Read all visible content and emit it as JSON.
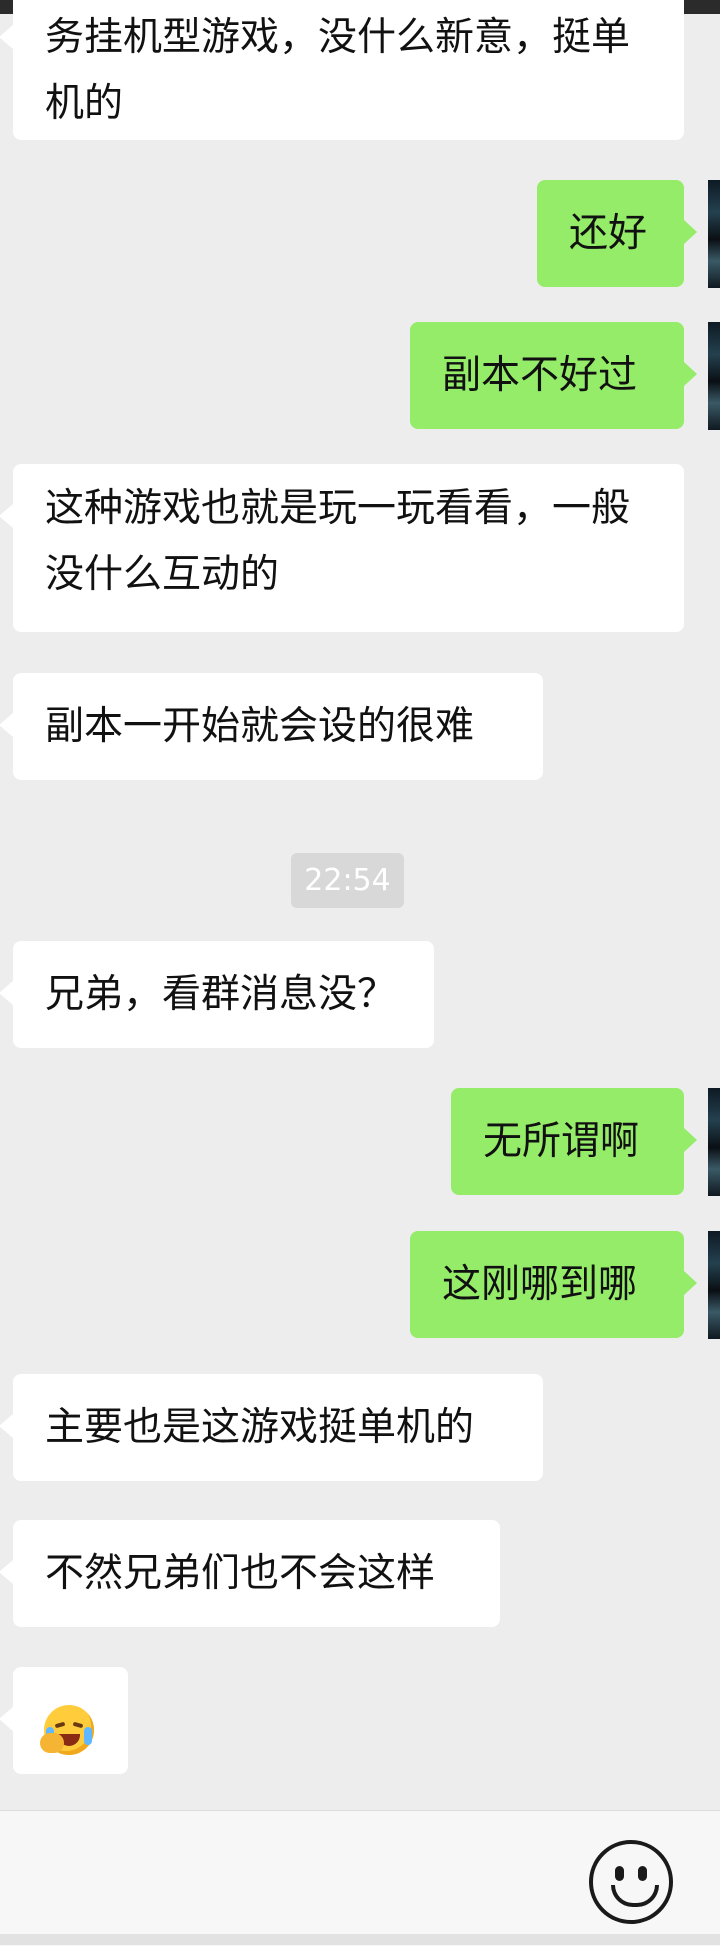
{
  "timestamp": "22:54",
  "messages": [
    {
      "side": "left",
      "text": "务挂机型游戏，没什么新意，挺单机的"
    },
    {
      "side": "right",
      "text": "还好"
    },
    {
      "side": "right",
      "text": "副本不好过"
    },
    {
      "side": "left",
      "text": "这种游戏也就是玩一玩看看，一般没什么互动的"
    },
    {
      "side": "left",
      "text": "副本一开始就会设的很难"
    },
    {
      "side": "left",
      "text": "兄弟，看群消息没？"
    },
    {
      "side": "right",
      "text": "无所谓啊"
    },
    {
      "side": "right",
      "text": "这刚哪到哪"
    },
    {
      "side": "left",
      "text": "主要也是这游戏挺单机的"
    },
    {
      "side": "left",
      "text": "不然兄弟们也不会这样"
    },
    {
      "side": "left",
      "emoji": "face-with-tears-covering-face-emoji"
    }
  ],
  "input_bar": {
    "emoji_button_icon": "smiley-face-icon"
  },
  "colors": {
    "background": "#ededed",
    "self_bubble": "#95ec69",
    "other_bubble": "#ffffff",
    "timestamp_bg": "#d8d8d8"
  }
}
